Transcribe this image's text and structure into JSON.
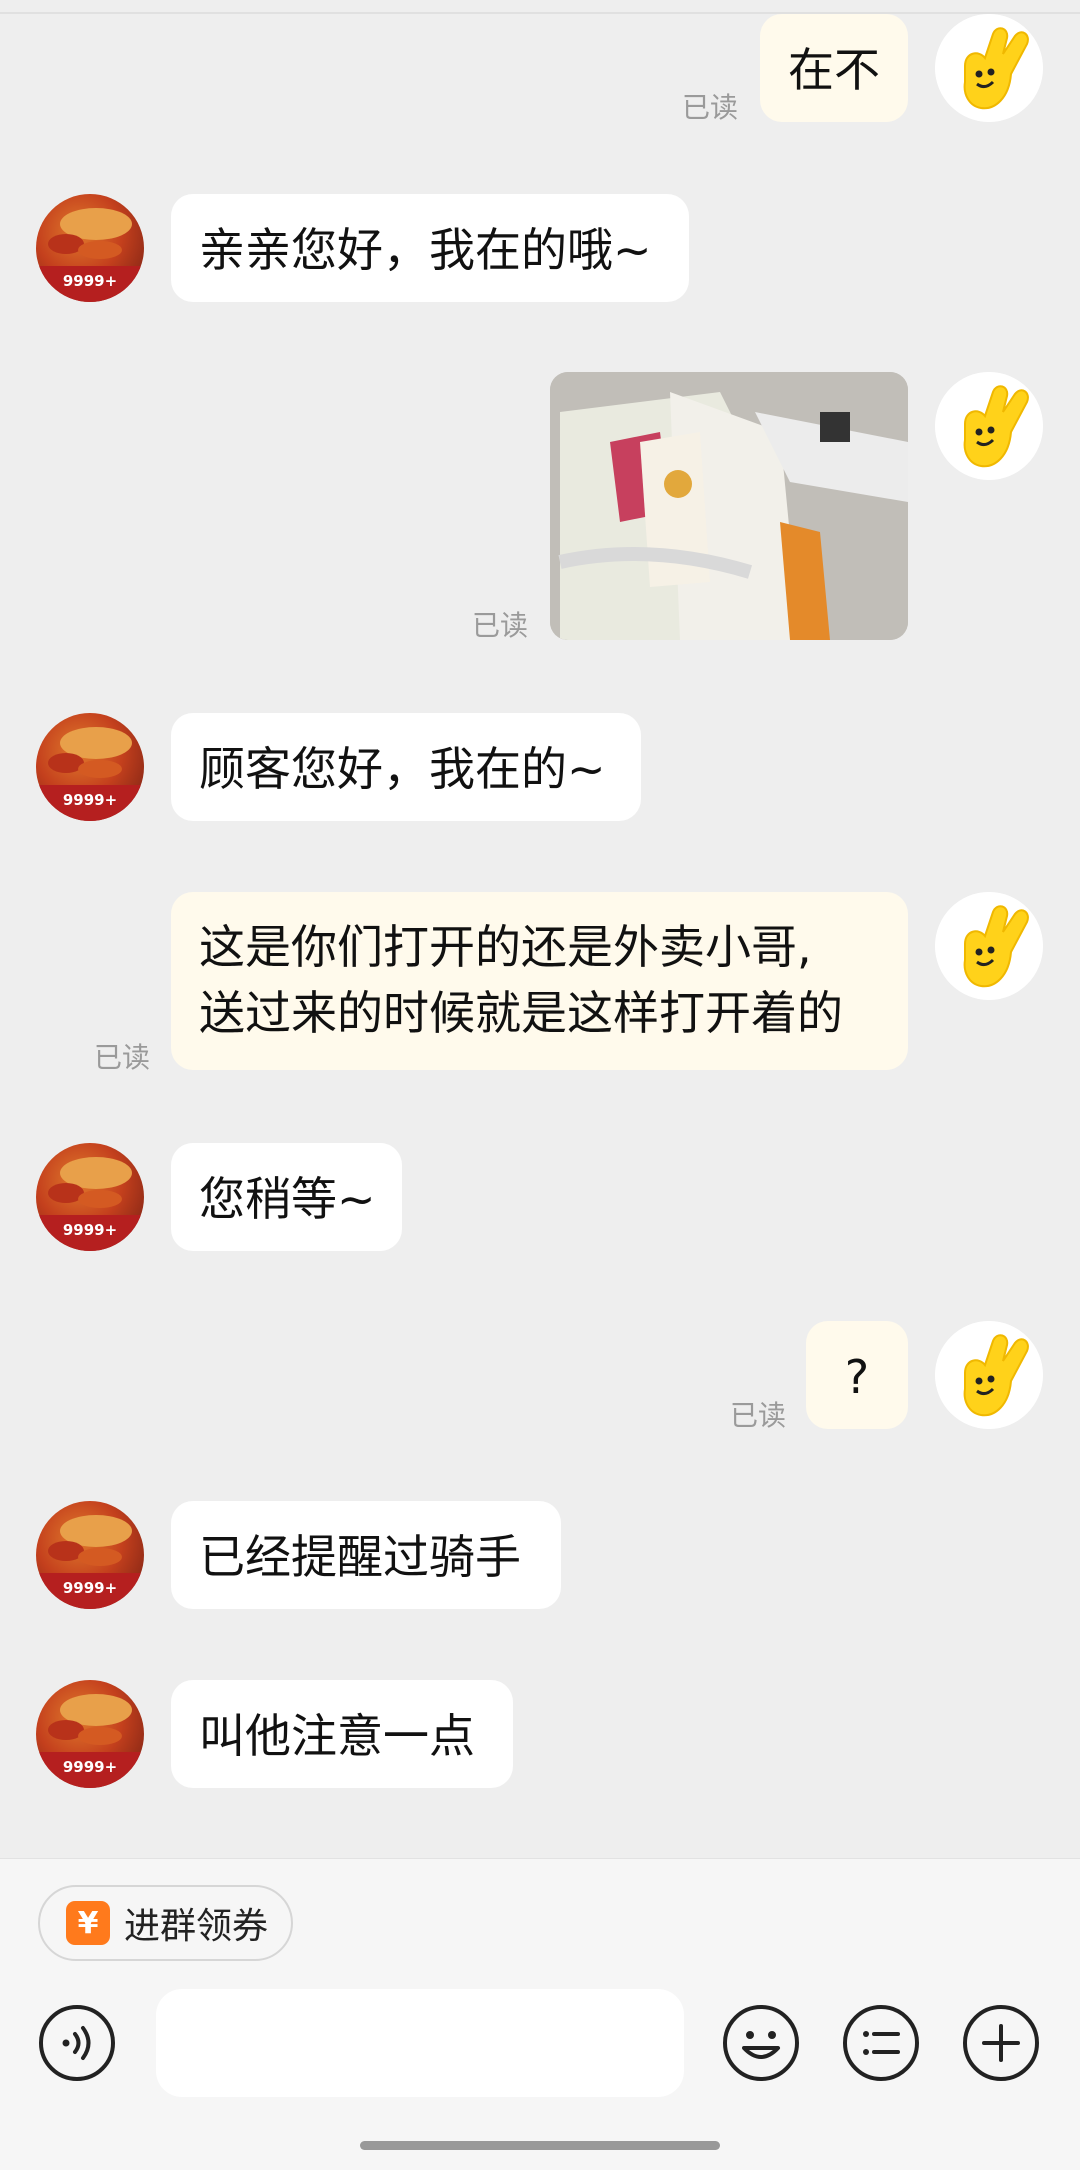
{
  "read_receipt": "已读",
  "messages": [
    {
      "side": "out",
      "text": "在不"
    },
    {
      "side": "in",
      "text": "亲亲您好，我在的哦~"
    },
    {
      "side": "out",
      "type": "image"
    },
    {
      "side": "in",
      "text": "顾客您好，我在的~"
    },
    {
      "side": "out",
      "lines": [
        "这是你们打开的还是外卖小哥,",
        "送过来的时候就是这样打开着的"
      ]
    },
    {
      "side": "in",
      "text": "您稍等~"
    },
    {
      "side": "out",
      "text": "?"
    },
    {
      "side": "in",
      "text": "已经提醒过骑手"
    },
    {
      "side": "in",
      "text": "叫他注意一点"
    }
  ],
  "shop_avatar_badge": "9999+",
  "footer": {
    "promo_chip_icon": "¥",
    "promo_chip_label": "进群领券",
    "input_placeholder": "",
    "icons": [
      "voice-icon",
      "emoji-icon",
      "quick-reply-icon",
      "plus-icon"
    ]
  },
  "colors": {
    "background": "#eeeeee",
    "incoming_bubble": "#ffffff",
    "outgoing_bubble": "#fffaec",
    "read_text": "#9a9a9a",
    "accent": "#ff7a1c",
    "user_avatar": "#ffd21a"
  }
}
